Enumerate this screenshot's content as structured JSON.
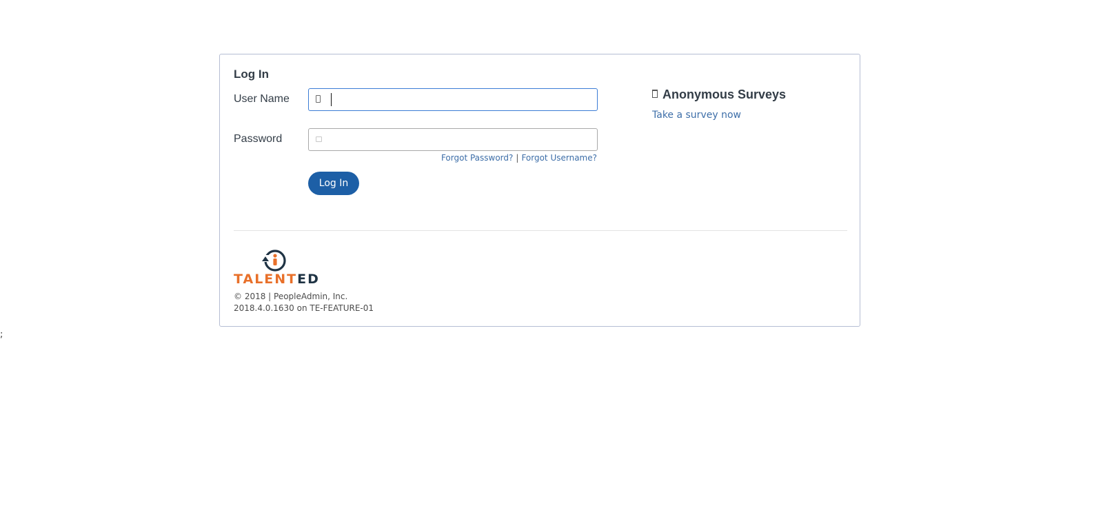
{
  "stray_text": ";",
  "login": {
    "title": "Log In",
    "username_label": "User Name",
    "username_value": "",
    "password_label": "Password",
    "password_value": "",
    "forgot_password": "Forgot Password?",
    "separator": "|",
    "forgot_username": "Forgot Username?",
    "button_label": "Log In"
  },
  "surveys": {
    "heading": "Anonymous Surveys",
    "icon": "clipboard-icon",
    "link": "Take a survey now"
  },
  "footer": {
    "logo_part1": "TALENT",
    "logo_part2": "ED",
    "copyright": "© 2018 | PeopleAdmin, Inc.",
    "version": "2018.4.0.1630 on TE-FEATURE-01"
  },
  "colors": {
    "accent": "#1d5fa6",
    "link": "#3d6ea8",
    "logo_orange": "#e8702a",
    "logo_navy": "#1f3344"
  }
}
